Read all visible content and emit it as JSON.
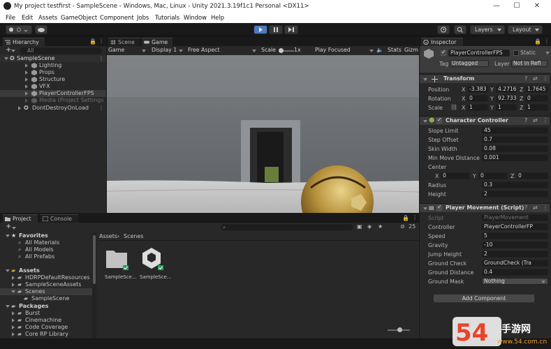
{
  "window": {
    "title": "My project testfirst - SampleScene - Windows, Mac, Linux - Unity 2021.3.19f1c1 Personal <DX11>",
    "minimize": "—",
    "maximize": "☐",
    "close": "✕"
  },
  "menu": [
    "File",
    "Edit",
    "Assets",
    "GameObject",
    "Component",
    "Jobs",
    "Tutorials",
    "Window",
    "Help"
  ],
  "toolbar": {
    "layers_label": "Layers",
    "layout_label": "Layout"
  },
  "hierarchy": {
    "tab": "Hierarchy",
    "search_placeholder": "All",
    "scene": "SampleScene",
    "items": [
      "Lighting",
      "Props",
      "Structure",
      "VFX",
      "PlayerControllerFPS",
      "Media (Project Settings > G"
    ],
    "dont_destroy": "DontDestroyOnLoad"
  },
  "viewport": {
    "tab_scene": "Scene",
    "tab_game": "Game",
    "game_dropdown": "Game",
    "display": "Display 1",
    "aspect": "Free Aspect",
    "scale_label": "Scale",
    "scale_value": "1x",
    "play_mode": "Play Focused",
    "stats": "Stats",
    "gizmos": "Gizm"
  },
  "project": {
    "tab_project": "Project",
    "tab_console": "Console",
    "count": "25",
    "breadcrumb_root": "Assets",
    "breadcrumb_sep": "›",
    "breadcrumb_leaf": "Scenes",
    "favorites": "Favorites",
    "fav_items": [
      "All Materials",
      "All Models",
      "All Prefabs"
    ],
    "assets": "Assets",
    "asset_items": [
      "HDRPDefaultResources",
      "SampleSceneAssets",
      "Scenes",
      "SampleScene"
    ],
    "packages": "Packages",
    "package_items": [
      "Burst",
      "Cinemachine",
      "Code Coverage",
      "Core RP Library"
    ],
    "grid_items": [
      "SampleSce...",
      "SampleSce..."
    ]
  },
  "inspector": {
    "tab": "Inspector",
    "object_name": "PlayerControllerFPS",
    "static_label": "Static",
    "tag_label": "Tag",
    "tag_value": "Untagged",
    "layer_label": "Layer",
    "layer_value": "Not in Refl",
    "transform": {
      "title": "Transform",
      "position_label": "Position",
      "rotation_label": "Rotation",
      "scale_label": "Scale",
      "position": [
        "-3.383",
        "4.2716",
        "1.7645"
      ],
      "rotation": [
        "0",
        "92.733",
        "0"
      ],
      "scale": [
        "1",
        "1",
        "1"
      ]
    },
    "character_controller": {
      "title": "Character Controller",
      "fields": [
        {
          "label": "Slope Limit",
          "value": "45"
        },
        {
          "label": "Step Offset",
          "value": "0.7"
        },
        {
          "label": "Skin Width",
          "value": "0.08"
        },
        {
          "label": "Min Move Distance",
          "value": "0.001"
        }
      ],
      "center_label": "Center",
      "center": [
        "0",
        "0",
        "0"
      ],
      "radius_label": "Radius",
      "radius": "0.3",
      "height_label": "Height",
      "height": "2"
    },
    "player_movement": {
      "title": "Player Movement (Script)",
      "script_label": "Script",
      "script_value": "PlayerMovement",
      "controller_label": "Controller",
      "controller_value": "PlayerControllerFP",
      "fields": [
        {
          "label": "Speed",
          "value": "5"
        },
        {
          "label": "Gravity",
          "value": "-10"
        },
        {
          "label": "Jump Height",
          "value": "2"
        }
      ],
      "ground_check_label": "Ground Check",
      "ground_check_value": "GroundCheck (Tra",
      "ground_distance_label": "Ground Distance",
      "ground_distance_value": "0.4",
      "ground_mask_label": "Ground Mask",
      "ground_mask_value": "Nothing"
    },
    "add_component": "Add Component"
  },
  "watermark": {
    "main": "54游",
    "side": "手游网",
    "url": "www.54.com.cn"
  },
  "colors": {
    "accent": "#2c5d87",
    "panel": "#282828",
    "background": "#191919",
    "play_active": "#4d7ac0"
  }
}
